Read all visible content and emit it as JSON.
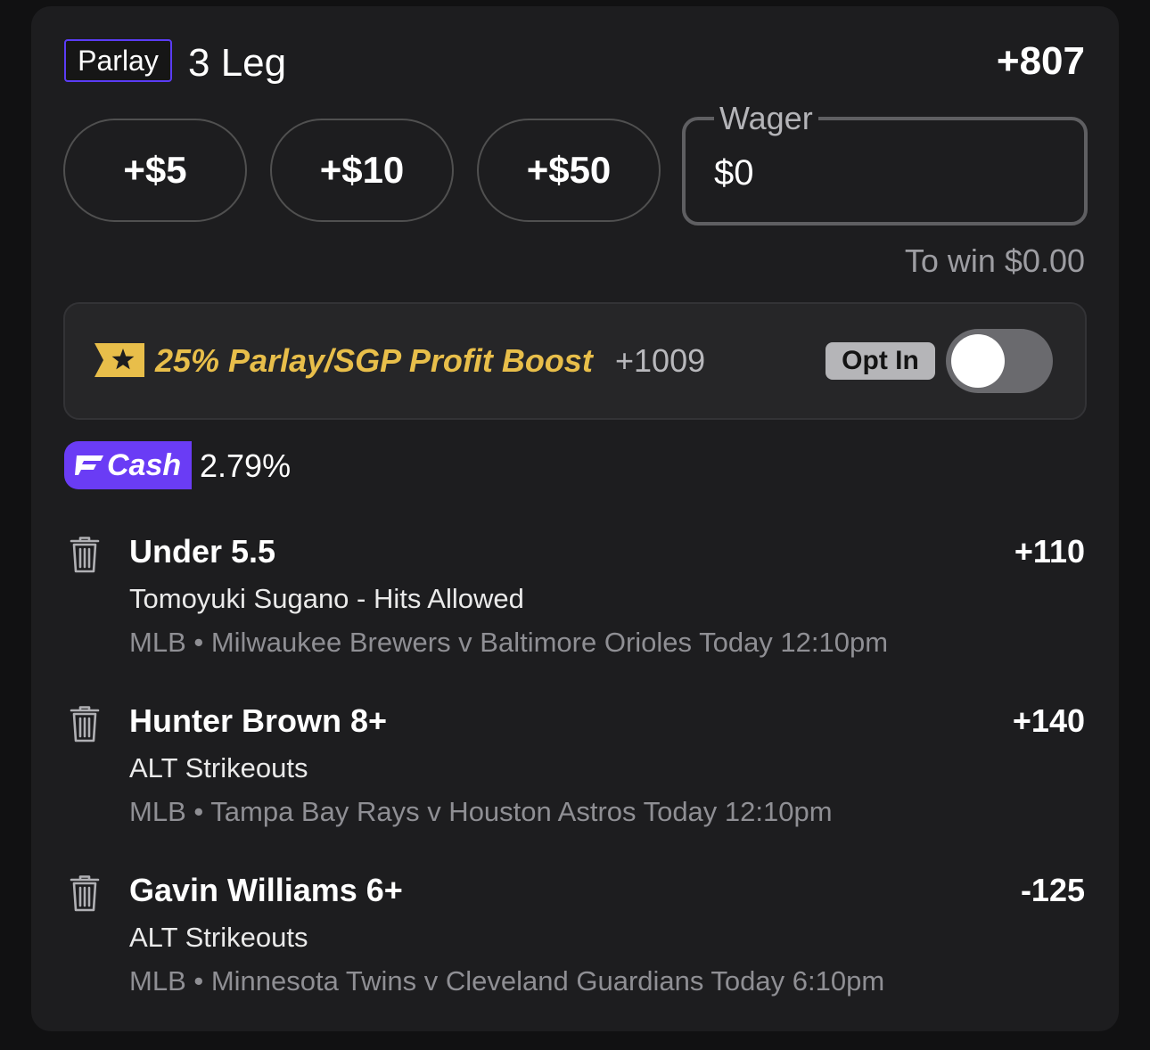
{
  "header": {
    "badge": "Parlay",
    "title": "3 Leg",
    "odds": "+807"
  },
  "quick_bets": [
    "+$5",
    "+$10",
    "+$50"
  ],
  "wager": {
    "label": "Wager",
    "value": "$0"
  },
  "to_win": "To win $0.00",
  "boost": {
    "icon": "boost-star-ticket-icon",
    "title": "25% Parlay/SGP Profit Boost",
    "odds": "+1009",
    "opt_in_label": "Opt In",
    "toggle_on": false,
    "accent_color": "#e8be4a"
  },
  "cash": {
    "label": "Cash",
    "value": "2.79%",
    "color": "#6a3cf5"
  },
  "legs": [
    {
      "name": "Under 5.5",
      "market": "Tomoyuki Sugano - Hits Allowed",
      "event": "MLB • Milwaukee Brewers v Baltimore Orioles Today 12:10pm",
      "odds": "+110"
    },
    {
      "name": "Hunter Brown 8+",
      "market": "ALT Strikeouts",
      "event": "MLB • Tampa Bay Rays v Houston Astros Today 12:10pm",
      "odds": "+140"
    },
    {
      "name": "Gavin Williams 6+",
      "market": "ALT Strikeouts",
      "event": "MLB • Minnesota Twins v Cleveland Guardians Today 6:10pm",
      "odds": "-125"
    }
  ]
}
